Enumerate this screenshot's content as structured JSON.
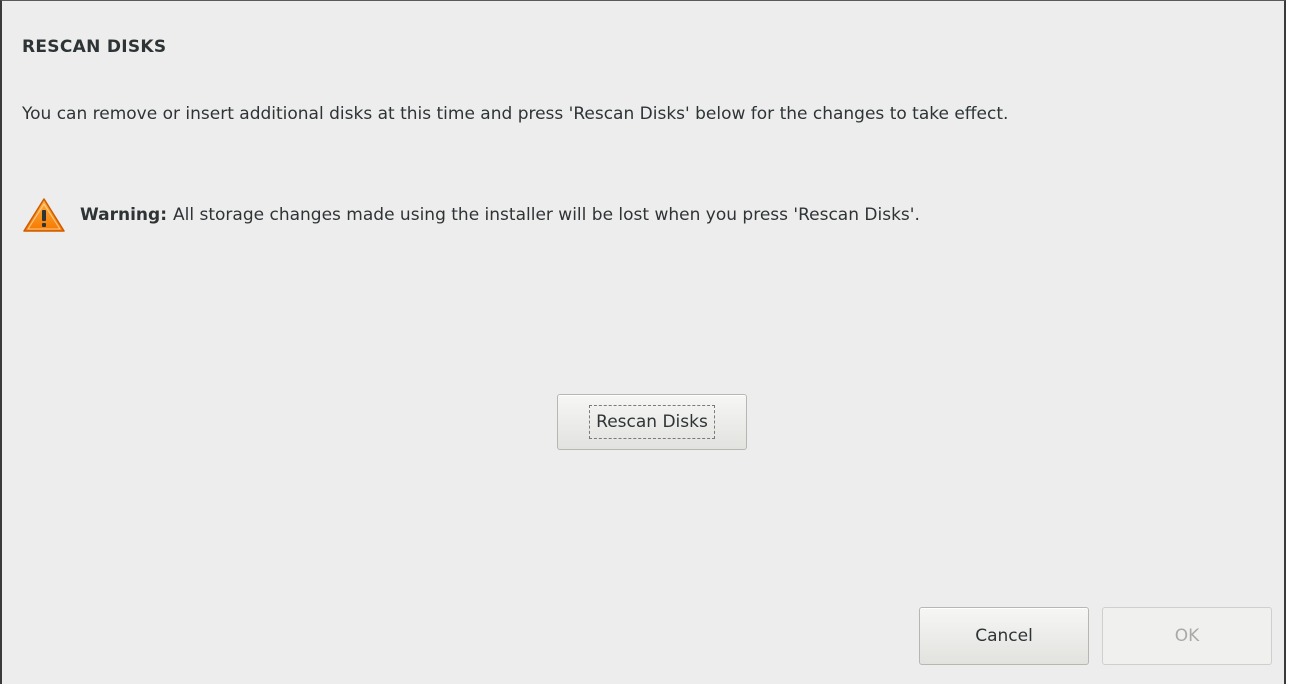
{
  "dialog": {
    "title": "RESCAN DISKS",
    "description": "You can remove or insert additional disks at this time and press 'Rescan Disks' below for the changes to take effect.",
    "warning": {
      "icon": "warning-triangle-icon",
      "label": "Warning:",
      "text": "All storage changes made using the installer will be lost when you press 'Rescan Disks'."
    },
    "rescan_button_label": "Rescan Disks",
    "footer": {
      "cancel_label": "Cancel",
      "ok_label": "OK",
      "ok_enabled": false
    }
  },
  "colors": {
    "background": "#ededed",
    "text": "#2e3436",
    "warning_orange": "#f57900",
    "disabled_text": "#a9aaa8"
  }
}
